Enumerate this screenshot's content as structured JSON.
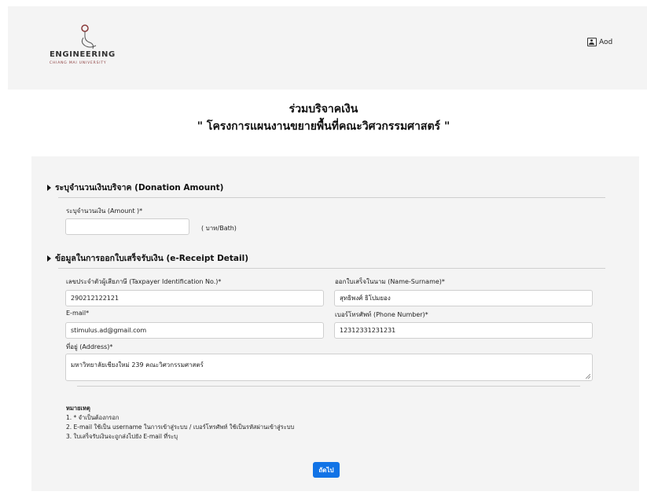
{
  "header": {
    "logo_main": "ENGINEERING",
    "logo_sub": "CHIANG MAI UNIVERSITY",
    "user_name": "Aod"
  },
  "page": {
    "title": "ร่วมบริจาคเงิน",
    "subtitle": "\" โครงการแผนงานขยายพื้นที่คณะวิศวกรรมศาสตร์ \""
  },
  "donation": {
    "section_title": "ระบุจำนวนเงินบริจาค (Donation Amount)",
    "amount_label": "ระบุจำนวนเงิน (Amount )*",
    "amount_value": "",
    "unit": "( บาท/Bath)"
  },
  "receipt": {
    "section_title": "ข้อมูลในการออกใบเสร็จรับเงิน (e-Receipt Detail)",
    "tax_id_label": "เลขประจำตัวผู้เสียภาษี (Taxpayer Identification No.)*",
    "tax_id_value": "290212122121",
    "name_label": "ออกใบเสร็จในนาม (Name-Surname)*",
    "name_value": "สุทธิพงศ์ ธิโปมยอง",
    "email_label": "E-mail*",
    "email_value": "stimulus.ad@gmail.com",
    "phone_label": "เบอร์โทรศัพท์ (Phone Number)*",
    "phone_value": "12312331231231",
    "address_label": "ที่อยู่ (Address)*",
    "address_value": "มหาวิทยาลัยเชียงใหม่ 239 คณะวิศวกรรมศาสตร์"
  },
  "notes": {
    "title": "หมายเหตุ",
    "items": [
      "1. * จำเป็นต้องกรอก",
      "2. E-mail ใช้เป็น username ในการเข้าสู่ระบบ / เบอร์โทรศัพท์ ใช้เป็นรหัสผ่านเข้าสู่ระบบ",
      "3. ใบเสร็จรับเงินจะถูกส่งไปยัง E-mail ที่ระบุ"
    ]
  },
  "actions": {
    "next_label": "ถัดไป"
  },
  "colors": {
    "primary": "#1173e6",
    "panel": "#f4f4f4",
    "logo_accent": "#8a3a3a"
  }
}
